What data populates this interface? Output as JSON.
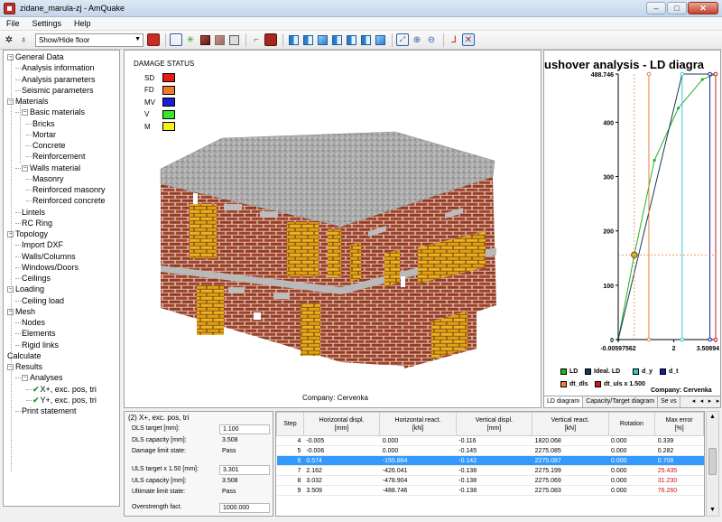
{
  "window": {
    "title": "zidane_marula-zj - AmQuake",
    "controls": [
      "–",
      "□",
      "✕"
    ]
  },
  "menu": [
    "File",
    "Settings",
    "Help"
  ],
  "toolbar": {
    "floor_combo": "Show/Hide floor"
  },
  "tree": [
    {
      "label": "General Data",
      "level": 0,
      "expander": "−"
    },
    {
      "label": "Analysis information",
      "level": 1
    },
    {
      "label": "Analysis parameters",
      "level": 1
    },
    {
      "label": "Seismic parameters",
      "level": 1
    },
    {
      "label": "Materials",
      "level": 0,
      "expander": "−"
    },
    {
      "label": "Basic materials",
      "level": 1,
      "expander": "−"
    },
    {
      "label": "Bricks",
      "level": 2
    },
    {
      "label": "Mortar",
      "level": 2
    },
    {
      "label": "Concrete",
      "level": 2
    },
    {
      "label": "Reinforcement",
      "level": 2
    },
    {
      "label": "Walls material",
      "level": 1,
      "expander": "−"
    },
    {
      "label": "Masonry",
      "level": 2
    },
    {
      "label": "Reinforced masonry",
      "level": 2
    },
    {
      "label": "Reinforced concrete",
      "level": 2
    },
    {
      "label": "Lintels",
      "level": 1
    },
    {
      "label": "RC Ring",
      "level": 1
    },
    {
      "label": "Topology",
      "level": 0,
      "expander": "−"
    },
    {
      "label": "Import DXF",
      "level": 1
    },
    {
      "label": "Walls/Columns",
      "level": 1
    },
    {
      "label": "Windows/Doors",
      "level": 1
    },
    {
      "label": "Ceilings",
      "level": 1
    },
    {
      "label": "Loading",
      "level": 0,
      "expander": "−"
    },
    {
      "label": "Ceiling load",
      "level": 1
    },
    {
      "label": "Mesh",
      "level": 0,
      "expander": "−"
    },
    {
      "label": "Nodes",
      "level": 1
    },
    {
      "label": "Elements",
      "level": 1
    },
    {
      "label": "Rigid links",
      "level": 1
    },
    {
      "label": "Calculate",
      "level": 0
    },
    {
      "label": "Results",
      "level": 0,
      "expander": "−"
    },
    {
      "label": "Analyses",
      "level": 1,
      "expander": "−"
    },
    {
      "label": "X+, exc. pos, tri",
      "level": 2,
      "check": true
    },
    {
      "label": "Y+, exc. pos, tri",
      "level": 2,
      "check": true
    },
    {
      "label": "Print statement",
      "level": 1
    }
  ],
  "damage_legend": {
    "title": "DAMAGE STATUS",
    "items": [
      {
        "label": "SD",
        "color": "#e8190f"
      },
      {
        "label": "FD",
        "color": "#f07a2a"
      },
      {
        "label": "MV",
        "color": "#1d1dd8"
      },
      {
        "label": "V",
        "color": "#35e82a"
      },
      {
        "label": "M",
        "color": "#f5f21a"
      }
    ]
  },
  "viewport_company": "Company: Cervenka",
  "chart_company": "Company: Cervenka",
  "chart_data": {
    "type": "line",
    "title": "ushover analysis - LD diagra",
    "x_ticks": [
      "-0.00597562",
      "2",
      "3.50894"
    ],
    "y_ticks": [
      "488.746",
      "400",
      "300",
      "200",
      "100",
      "0"
    ],
    "xlim": [
      -0.00597562,
      3.50894
    ],
    "ylim": [
      0,
      488.746
    ],
    "series": [
      {
        "name": "LD",
        "color": "#23b023",
        "x": [
          -0.00597562,
          0.574,
          1.3,
          2.162,
          3.032,
          3.509
        ],
        "y": [
          0,
          155.864,
          330,
          426.041,
          478.904,
          488.746
        ]
      },
      {
        "name": "Ideal. LD",
        "color": "#123c50",
        "x": [
          -0.00597562,
          2.3,
          3.509
        ],
        "y": [
          0,
          488.746,
          488.746
        ]
      },
      {
        "name": "d_y",
        "color": "#33c7d6",
        "vertical_at": 2.3
      },
      {
        "name": "d_t",
        "color": "#1a1aa8",
        "vertical_at": 3.301
      },
      {
        "name": "dt_dls",
        "color": "#e8803a",
        "vertical_at": 1.1
      },
      {
        "name": "dt_uls x 1.500",
        "color": "#d01818",
        "vertical_at": 3.509
      }
    ],
    "marker_point": {
      "x": 0.574,
      "y": 155.864
    }
  },
  "chart_tabs": [
    "LD diagram",
    "Capacity/Target diagram",
    "Se vs"
  ],
  "summary": {
    "title": "(2) X+, exc. pos, tri",
    "dls_target_label": "DLS target [mm]:",
    "dls_target": "1.100",
    "dls_capacity_label": "DLS capacity [mm]:",
    "dls_capacity": "3.508",
    "damage_limit_label": "Damage limit state:",
    "damage_limit": "Pass",
    "uls_target_label": "ULS target x 1.50 [mm]:",
    "uls_target": "3.301",
    "uls_capacity_label": "ULS capacity [mm]:",
    "uls_capacity": "3.508",
    "ultimate_limit_label": "Ultimate limit state:",
    "ultimate_limit": "Pass",
    "overstrength_label": "Overstrength fact.",
    "overstrength": "1000.000"
  },
  "table": {
    "headers": [
      "Step",
      "Horizontal displ.\n[mm]",
      "Horizontal react.\n[kN]",
      "Vertical displ.\n[mm]",
      "Vertical react.\n[kN]",
      "Rotation",
      "Max error\n[%]"
    ],
    "rows": [
      {
        "step": "4",
        "hd": "-0.005",
        "hr": "0.000",
        "vd": "-0.116",
        "vr": "1820.068",
        "rot": "0.000",
        "err": "0.339",
        "err_red": false,
        "selected": false
      },
      {
        "step": "5",
        "hd": "-0.006",
        "hr": "0.000",
        "vd": "-0.145",
        "vr": "2275.085",
        "rot": "0.000",
        "err": "0.282",
        "err_red": false,
        "selected": false
      },
      {
        "step": "6",
        "hd": "0.574",
        "hr": "-155.864",
        "vd": "-0.142",
        "vr": "2275.087",
        "rot": "0.000",
        "err": "0.708",
        "err_red": false,
        "selected": true
      },
      {
        "step": "7",
        "hd": "2.162",
        "hr": "-426.041",
        "vd": "-0.138",
        "vr": "2275.199",
        "rot": "0.000",
        "err": "25.435",
        "err_red": true,
        "selected": false
      },
      {
        "step": "8",
        "hd": "3.032",
        "hr": "-478.904",
        "vd": "-0.138",
        "vr": "2275.069",
        "rot": "0.000",
        "err": "31.230",
        "err_red": true,
        "selected": false
      },
      {
        "step": "9",
        "hd": "3.509",
        "hr": "-488.746",
        "vd": "-0.138",
        "vr": "2275.083",
        "rot": "0.000",
        "err": "76.260",
        "err_red": true,
        "selected": false
      }
    ]
  }
}
